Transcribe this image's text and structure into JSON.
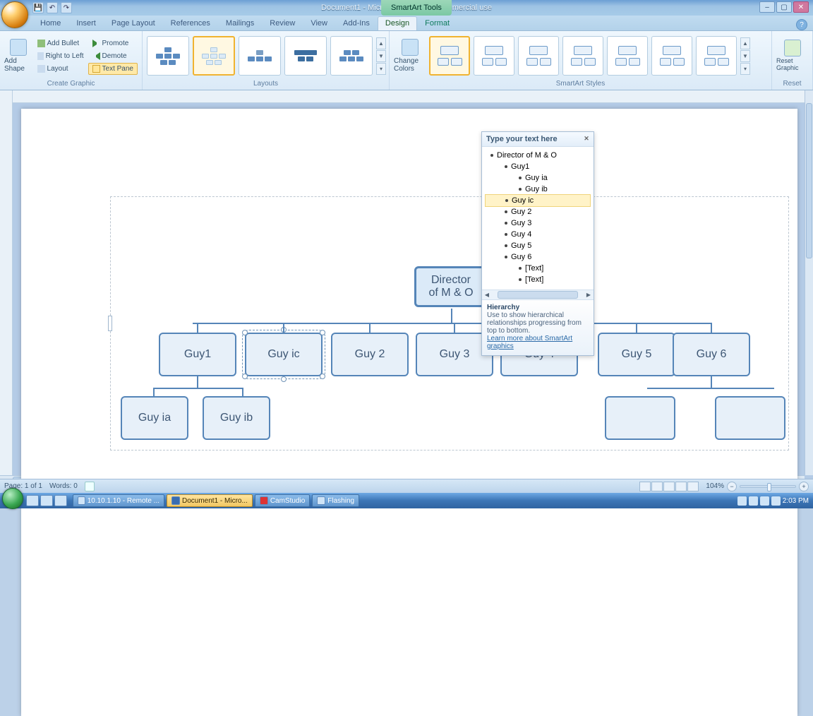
{
  "window": {
    "title": "Document1 - Microsoft Word non-commercial use",
    "tools_tab": "SmartArt Tools",
    "min": "–",
    "max": "▢",
    "close": "✕"
  },
  "qat": {
    "save": "💾",
    "undo": "↶",
    "redo": "↷"
  },
  "tabs": {
    "home": "Home",
    "insert": "Insert",
    "page_layout": "Page Layout",
    "references": "References",
    "mailings": "Mailings",
    "review": "Review",
    "view": "View",
    "addins": "Add-Ins",
    "design": "Design",
    "format": "Format"
  },
  "ribbon": {
    "create_graphic": {
      "label": "Create Graphic",
      "add_shape": "Add Shape",
      "add_bullet": "Add Bullet",
      "right_to_left": "Right to Left",
      "layout": "Layout",
      "promote": "Promote",
      "demote": "Demote",
      "text_pane": "Text Pane"
    },
    "layouts": {
      "label": "Layouts"
    },
    "change_colors": "Change Colors",
    "styles": {
      "label": "SmartArt Styles"
    },
    "reset": {
      "label": "Reset",
      "btn": "Reset Graphic"
    }
  },
  "text_pane": {
    "title": "Type your text here",
    "items": [
      {
        "lvl": 1,
        "text": "Director of M & O"
      },
      {
        "lvl": 2,
        "text": "Guy1"
      },
      {
        "lvl": 3,
        "text": "Guy ia"
      },
      {
        "lvl": 3,
        "text": "Guy ib"
      },
      {
        "lvl": 2,
        "text": "Guy ic",
        "selected": true
      },
      {
        "lvl": 2,
        "text": "Guy 2"
      },
      {
        "lvl": 2,
        "text": "Guy 3"
      },
      {
        "lvl": 2,
        "text": "Guy 4"
      },
      {
        "lvl": 2,
        "text": "Guy 5"
      },
      {
        "lvl": 2,
        "text": "Guy 6"
      },
      {
        "lvl": 3,
        "text": "[Text]"
      },
      {
        "lvl": 3,
        "text": "[Text]"
      }
    ],
    "info_title": "Hierarchy",
    "info_body": "Use to show hierarchical relationships progressing from top to bottom.",
    "info_link": "Learn more about SmartArt graphics"
  },
  "chart_data": {
    "type": "hierarchy",
    "root": "Director of M & O",
    "children": [
      {
        "name": "Guy1",
        "children": [
          {
            "name": "Guy ia"
          },
          {
            "name": "Guy ib"
          }
        ]
      },
      {
        "name": "Guy ic",
        "selected": true
      },
      {
        "name": "Guy 2"
      },
      {
        "name": "Guy 3"
      },
      {
        "name": "Guy 4"
      },
      {
        "name": "Guy 5"
      },
      {
        "name": "Guy 6",
        "children": [
          {
            "name": "[Text]"
          },
          {
            "name": "[Text]"
          }
        ]
      }
    ]
  },
  "nodes": {
    "root_l1": "Director",
    "root_l2": "of M & O",
    "n1": "Guy1",
    "n2": "Guy ic",
    "n3": "Guy 2",
    "n4": "Guy 3",
    "n5": "Guy 4",
    "n6": "Guy 5",
    "n7": "Guy 6",
    "c1": "Guy ia",
    "c2": "Guy ib"
  },
  "status": {
    "page": "Page: 1 of 1",
    "words": "Words: 0",
    "zoom": "104%"
  },
  "taskbar": {
    "rdp": "10.10.1.10 - Remote ...",
    "word": "Document1 - Micro...",
    "cam": "CamStudio",
    "flash": "Flashing",
    "time": "2:03 PM"
  }
}
